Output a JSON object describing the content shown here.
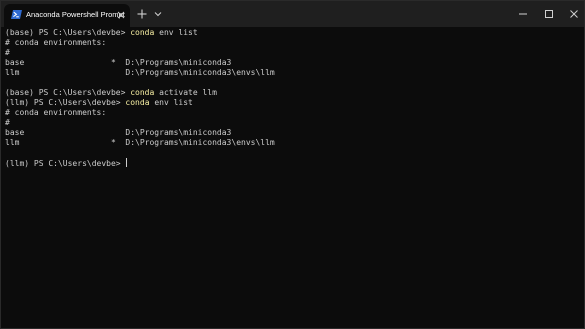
{
  "window": {
    "tab_title": "Anaconda Powershell Prompt",
    "icons": {
      "tab_icon": "powershell-icon",
      "close": "close-icon",
      "new_tab": "plus-icon",
      "dropdown": "chevron-down-icon",
      "minimize": "minimize-icon",
      "maximize": "maximize-icon",
      "window_close": "close-icon"
    }
  },
  "colors": {
    "background": "#0c0c0c",
    "titlebar": "#1f1f1f",
    "text": "#cccccc",
    "command": "#f9f1a5"
  },
  "terminal": {
    "lines": [
      {
        "type": "prompt",
        "prompt": "(base) PS C:\\Users\\devbe> ",
        "command": "conda",
        "args": " env list"
      },
      {
        "type": "text",
        "text": "# conda environments:"
      },
      {
        "type": "text",
        "text": "#"
      },
      {
        "type": "text",
        "text": "base                  *  D:\\Programs\\miniconda3"
      },
      {
        "type": "text",
        "text": "llm                      D:\\Programs\\miniconda3\\envs\\llm"
      },
      {
        "type": "text",
        "text": ""
      },
      {
        "type": "prompt",
        "prompt": "(base) PS C:\\Users\\devbe> ",
        "command": "conda",
        "args": " activate llm"
      },
      {
        "type": "prompt",
        "prompt": "(llm) PS C:\\Users\\devbe> ",
        "command": "conda",
        "args": " env list"
      },
      {
        "type": "text",
        "text": "# conda environments:"
      },
      {
        "type": "text",
        "text": "#"
      },
      {
        "type": "text",
        "text": "base                     D:\\Programs\\miniconda3"
      },
      {
        "type": "text",
        "text": "llm                   *  D:\\Programs\\miniconda3\\envs\\llm"
      },
      {
        "type": "text",
        "text": ""
      },
      {
        "type": "current",
        "prompt": "(llm) PS C:\\Users\\devbe> "
      }
    ]
  }
}
